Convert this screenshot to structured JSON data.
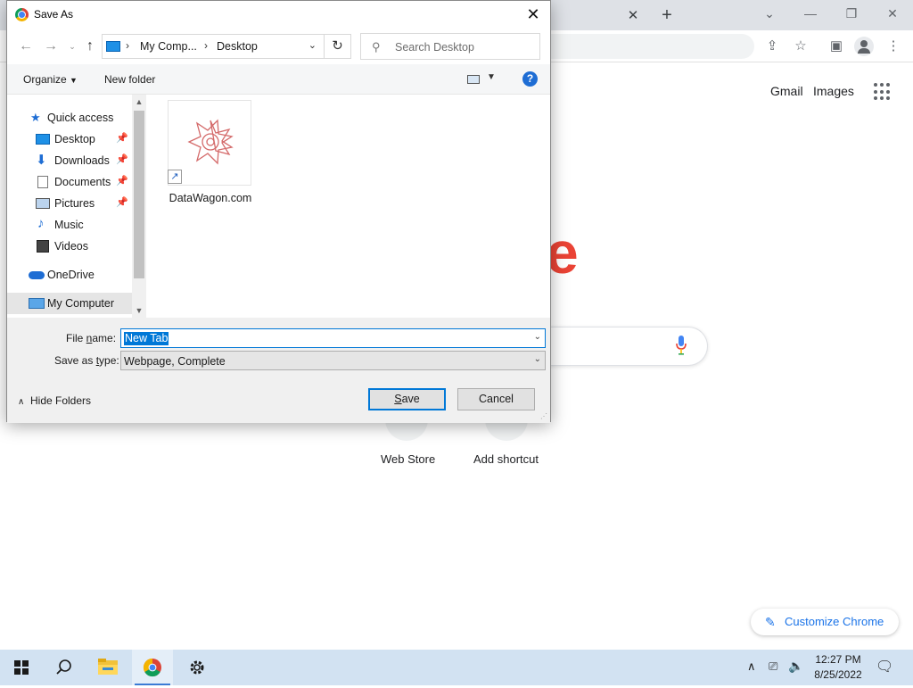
{
  "browser": {
    "tab_close": "✕",
    "new_tab": "+",
    "links": [
      "Gmail",
      "Images"
    ],
    "logo_fragment": "e",
    "shortcuts": [
      "Web Store",
      "Add shortcut"
    ],
    "customize_label": "Customize Chrome"
  },
  "dialog": {
    "title": "Save As",
    "breadcrumb": [
      "My Comp...",
      "Desktop"
    ],
    "search_placeholder": "Search Desktop",
    "commands": {
      "organize": "Organize",
      "new_folder": "New folder",
      "help": "?"
    },
    "nav_items": [
      {
        "label": "Quick access",
        "icon": "star-icon",
        "pinned": false
      },
      {
        "label": "Desktop",
        "icon": "desktop-icon",
        "pinned": true
      },
      {
        "label": "Downloads",
        "icon": "download-icon",
        "pinned": true
      },
      {
        "label": "Documents",
        "icon": "documents-icon",
        "pinned": true
      },
      {
        "label": "Pictures",
        "icon": "pictures-icon",
        "pinned": true
      },
      {
        "label": "Music",
        "icon": "music-icon",
        "pinned": false
      },
      {
        "label": "Videos",
        "icon": "videos-icon",
        "pinned": false
      },
      {
        "label": "OneDrive",
        "icon": "cloud-icon",
        "pinned": false
      },
      {
        "label": "My Computer",
        "icon": "computer-icon",
        "pinned": false,
        "selected": true
      }
    ],
    "files": [
      {
        "name": "DataWagon.com",
        "type": "shortcut"
      }
    ],
    "file_name_label": "File name:",
    "file_name_value": "New Tab",
    "save_type_label": "Save as type:",
    "save_type_value": "Webpage, Complete",
    "hide_folders": "Hide Folders",
    "save_button": "Save",
    "cancel_button": "Cancel"
  },
  "taskbar": {
    "time": "12:27 PM",
    "date": "8/25/2022"
  },
  "colors": {
    "accent": "#0078d7",
    "taskbar": "#d2e2f2",
    "logo_red": "#ea4335",
    "chrome_blue": "#1a73e8"
  }
}
